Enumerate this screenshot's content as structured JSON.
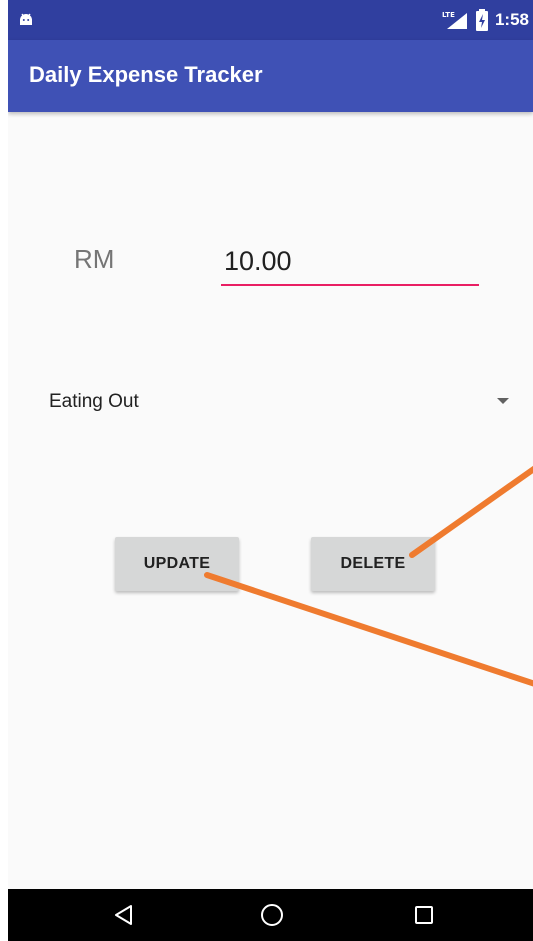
{
  "status_bar": {
    "time": "1:58",
    "network": "LTE",
    "icons": [
      "android-debug-icon",
      "lte-signal-icon",
      "battery-charging-icon"
    ]
  },
  "app_bar": {
    "title": "Daily Expense Tracker"
  },
  "form": {
    "currency_label": "RM",
    "amount_value": "10.00",
    "category_selected": "Eating Out"
  },
  "buttons": {
    "update_label": "UPDATE",
    "delete_label": "DELETE"
  },
  "nav": {
    "icons": [
      "back-icon",
      "home-icon",
      "recents-icon"
    ]
  },
  "colors": {
    "status_bar": "#303f9f",
    "app_bar": "#3f51b5",
    "input_underline": "#e91e63",
    "button_bg": "#d6d7d7",
    "annotation_arrow": "#ef7b2f"
  }
}
